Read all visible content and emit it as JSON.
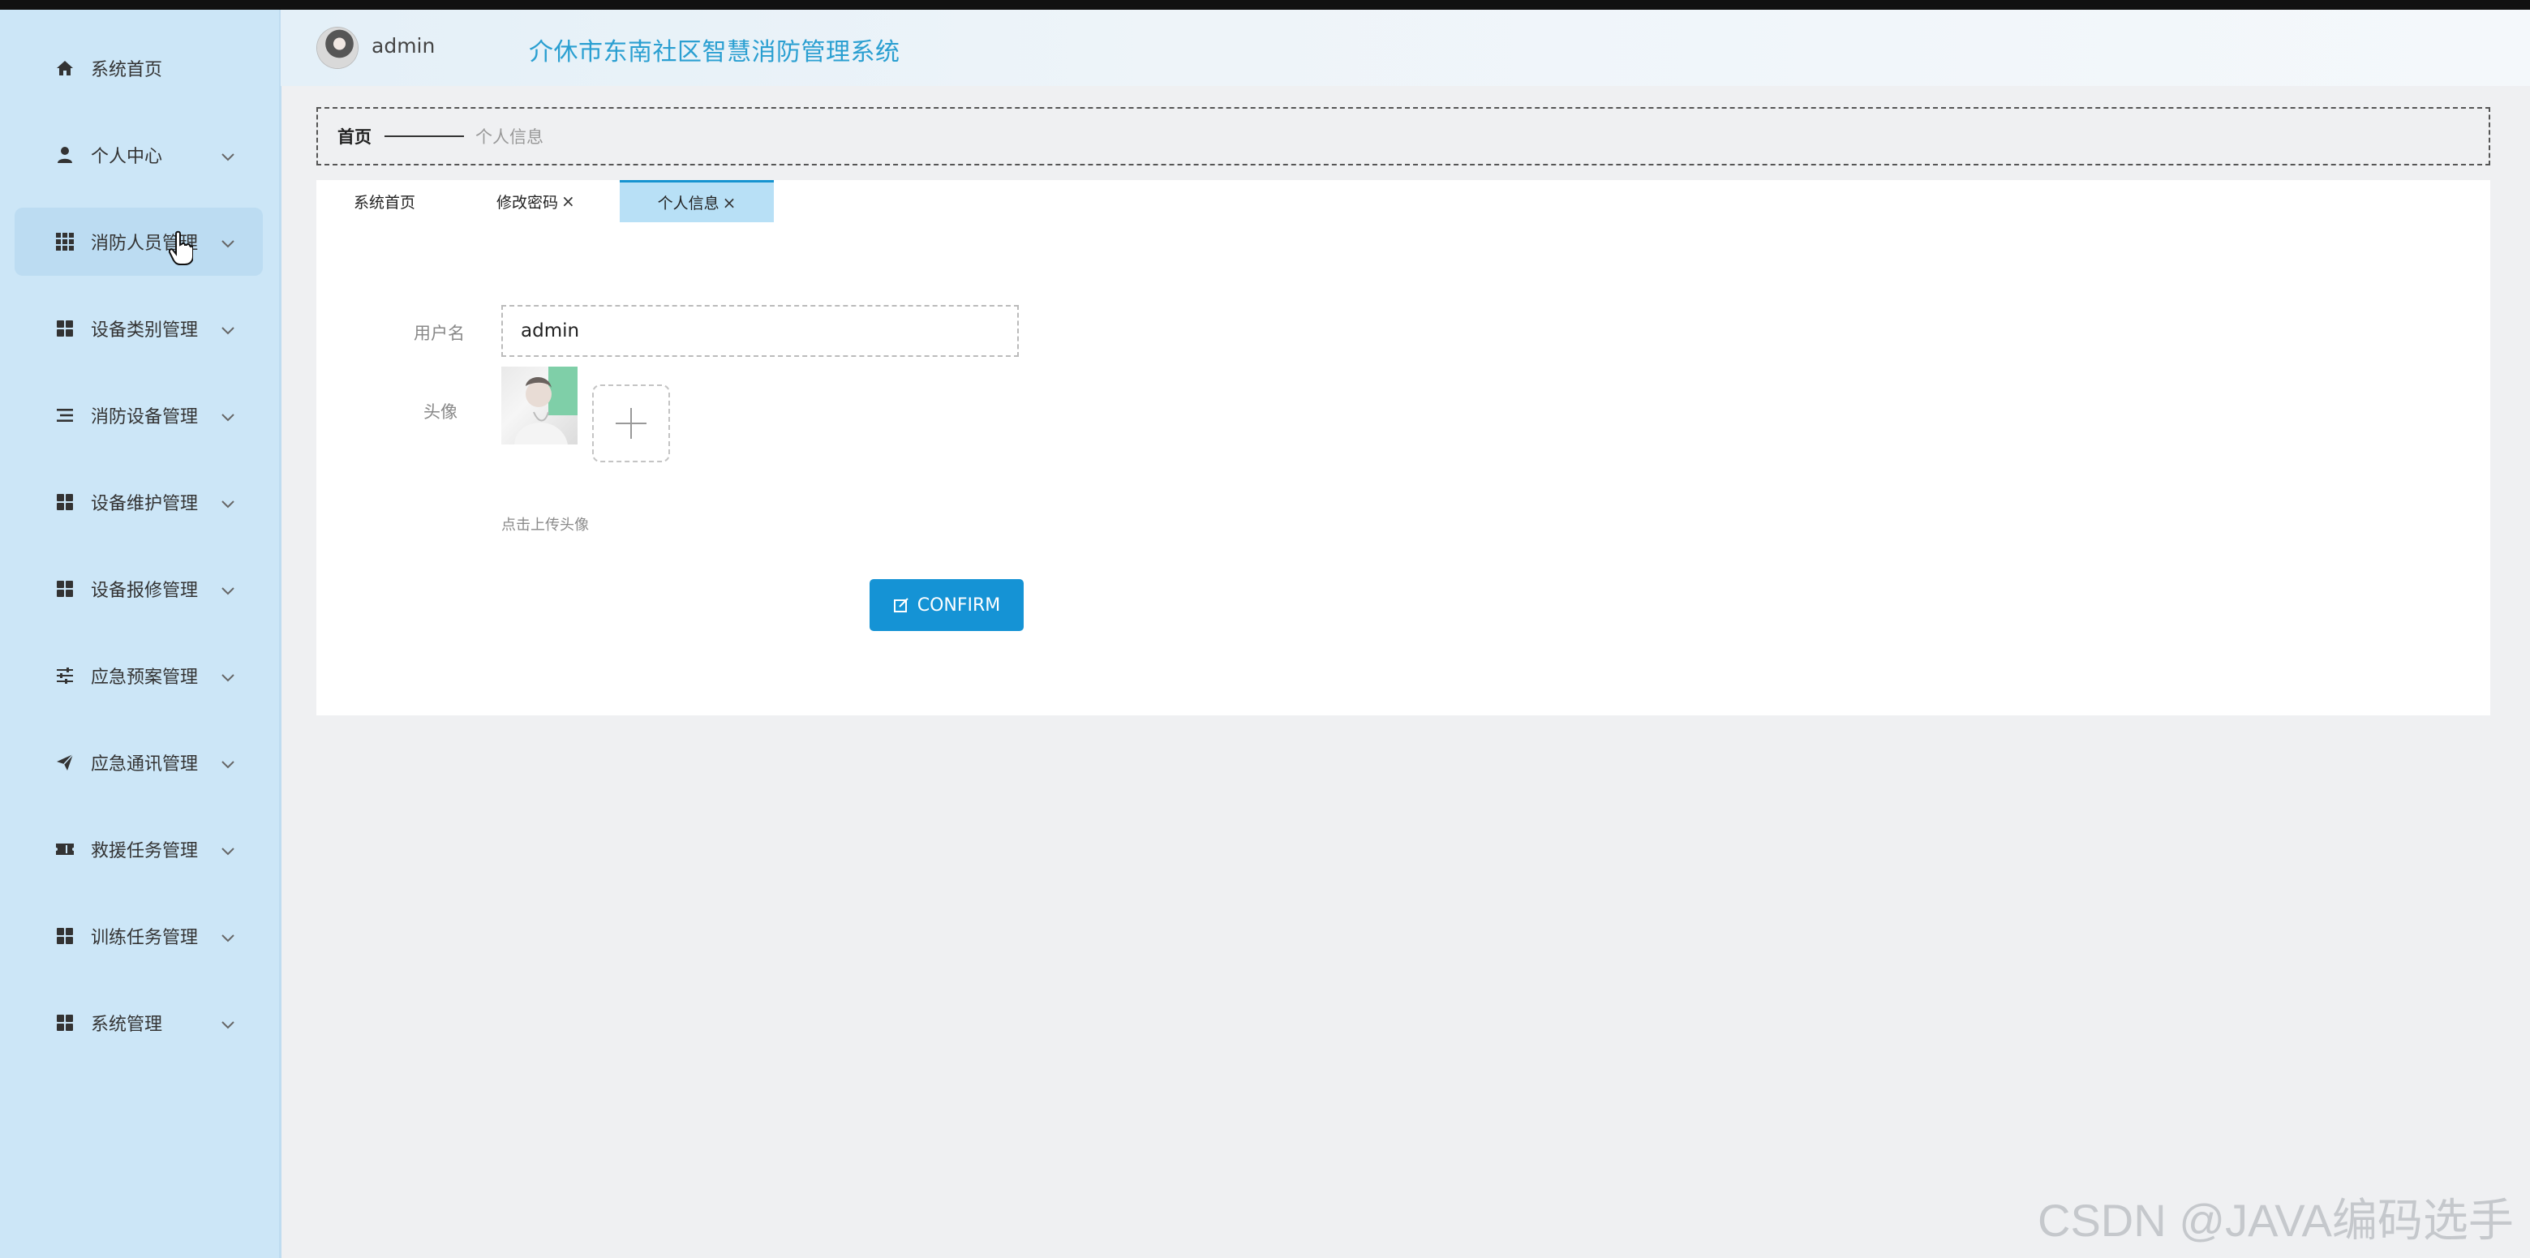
{
  "header": {
    "username": "admin",
    "title": "介休市东南社区智慧消防管理系统"
  },
  "sidebar": {
    "items": [
      {
        "label": "系统首页",
        "icon": "home-icon",
        "has_submenu": false
      },
      {
        "label": "个人中心",
        "icon": "user-icon",
        "has_submenu": true
      },
      {
        "label": "消防人员管理",
        "icon": "grid-icon",
        "has_submenu": true,
        "active": true
      },
      {
        "label": "设备类别管理",
        "icon": "apps-icon",
        "has_submenu": true
      },
      {
        "label": "消防设备管理",
        "icon": "list-icon",
        "has_submenu": true
      },
      {
        "label": "设备维护管理",
        "icon": "apps-icon",
        "has_submenu": true
      },
      {
        "label": "设备报修管理",
        "icon": "apps-icon",
        "has_submenu": true
      },
      {
        "label": "应急预案管理",
        "icon": "sliders-icon",
        "has_submenu": true
      },
      {
        "label": "应急通讯管理",
        "icon": "send-icon",
        "has_submenu": true
      },
      {
        "label": "救援任务管理",
        "icon": "ticket-icon",
        "has_submenu": true
      },
      {
        "label": "训练任务管理",
        "icon": "apps-icon",
        "has_submenu": true
      },
      {
        "label": "系统管理",
        "icon": "apps-icon",
        "has_submenu": true
      }
    ]
  },
  "breadcrumb": {
    "home": "首页",
    "current": "个人信息"
  },
  "tabs": [
    {
      "label": "系统首页",
      "closable": false,
      "active": false
    },
    {
      "label": "修改密码",
      "closable": true,
      "active": false
    },
    {
      "label": "个人信息",
      "closable": true,
      "active": true
    }
  ],
  "form": {
    "username_label": "用户名",
    "username_value": "admin",
    "avatar_label": "头像",
    "upload_hint": "点击上传头像",
    "confirm_label": "CONFIRM"
  },
  "watermark": "CSDN @JAVA编码选手",
  "colors": {
    "sidebar_bg": "#cce6f7",
    "accent": "#1593d5",
    "title": "#2a9fd1",
    "active_tab": "#b8e0f6"
  }
}
